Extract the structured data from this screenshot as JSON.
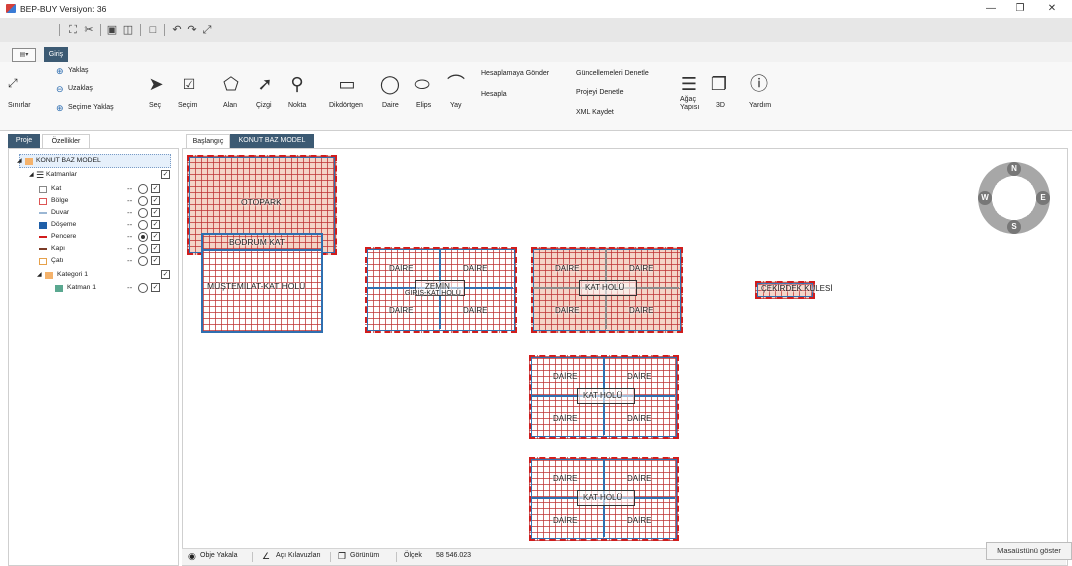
{
  "window": {
    "title": "BEP-BUY Versiyon: 36"
  },
  "ribbon": {
    "tab": "Giriş",
    "zoom_in": "Yaklaş",
    "zoom_out": "Uzaklaş",
    "zoom_selection": "Seçime Yaklaş",
    "limits": "Sınırlar",
    "select": "Seç",
    "selection": "Seçim",
    "area": "Alan",
    "line": "Çizgi",
    "point": "Nokta",
    "rectangle": "Dikdörtgen",
    "circle": "Daire",
    "ellipse": "Elips",
    "arc": "Yay",
    "send_calc": "Hesaplamaya Gönder",
    "calc": "Hesapla",
    "check_updates": "Güncellemeleri Denetle",
    "check_project": "Projeyi Denetle",
    "save_xml": "XML Kaydet",
    "tree_line1": "Ağaç",
    "tree_line2": "Yapısı",
    "three_d": "3D",
    "help": "Yardım"
  },
  "left_tabs": [
    "Proje",
    "Özellikler"
  ],
  "tree": {
    "root": "KONUT BAZ MODEL",
    "layers": "Katmanlar",
    "items": [
      "Kat",
      "Bölge",
      "Duvar",
      "Döşeme",
      "Pencere",
      "Kapı",
      "Çatı"
    ],
    "category": "Kategori 1",
    "sublayer": "Katman 1"
  },
  "doc_tabs": [
    "Başlangıç",
    "KONUT BAZ MODEL"
  ],
  "plans": {
    "otopark": "OTOPARK",
    "bodrum": "BODRUM KAT",
    "mustemilat": "MÜŞTEMİLAT-KAT HOLÜ",
    "daire": "DAİRE",
    "zemin": "ZEMİN",
    "giris_holu": "GİRİŞ-KAT HOLÜ",
    "kat_holu": "KAT HOLÜ",
    "cekirdek": "ÇEKİRDEK KULESİ"
  },
  "compass": {
    "n": "N",
    "s": "S",
    "w": "W",
    "e": "E"
  },
  "status": {
    "snap": "Obje Yakala",
    "angle_guides": "Açı Kılavuzları",
    "view": "Görünüm",
    "scale_label": "Ölçek",
    "scale_value": "58 546.023"
  },
  "desktop_tip": "Masaüstünü göster"
}
